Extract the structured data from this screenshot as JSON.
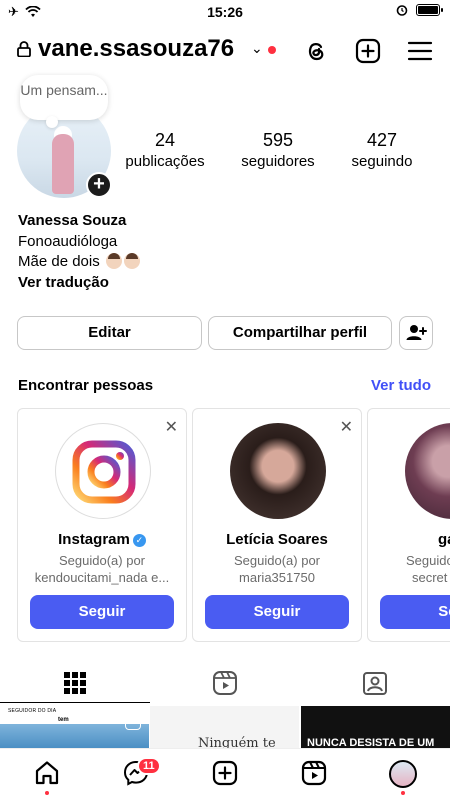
{
  "status_bar": {
    "time": "15:26"
  },
  "header": {
    "username": "vane.ssasouza76"
  },
  "profile": {
    "note": "Um pensam...",
    "stats": [
      {
        "value": "24",
        "label": "publicações"
      },
      {
        "value": "595",
        "label": "seguidores"
      },
      {
        "value": "427",
        "label": "seguindo"
      }
    ],
    "name": "Vanessa Souza",
    "bio_line1": "Fonoaudióloga",
    "bio_line2": "Mãe de dois",
    "translate": "Ver tradução"
  },
  "actions": {
    "edit": "Editar",
    "share": "Compartilhar perfil"
  },
  "find_people": {
    "title": "Encontrar pessoas",
    "see_all": "Ver tudo",
    "cards": [
      {
        "name": "Instagram",
        "line1": "Seguido(a) por",
        "line2": "kendoucitami_nada e...",
        "button": "Seguir"
      },
      {
        "name": "Letícia Soares",
        "line1": "Seguido(a) por",
        "line2": "maria351750",
        "button": "Seguir"
      },
      {
        "name": "ga",
        "line1": "Seguido",
        "line2": "secret",
        "button": "Seg"
      }
    ]
  },
  "grid": {
    "thumb1_caption": "SEGUIDOR DO DIA",
    "thumb1_caption2": "tem",
    "thumb2_text": "Ninguém te",
    "thumb3_text": "NUNCA DESISTA DE UM"
  },
  "bottom_nav": {
    "messages_badge": "11"
  }
}
